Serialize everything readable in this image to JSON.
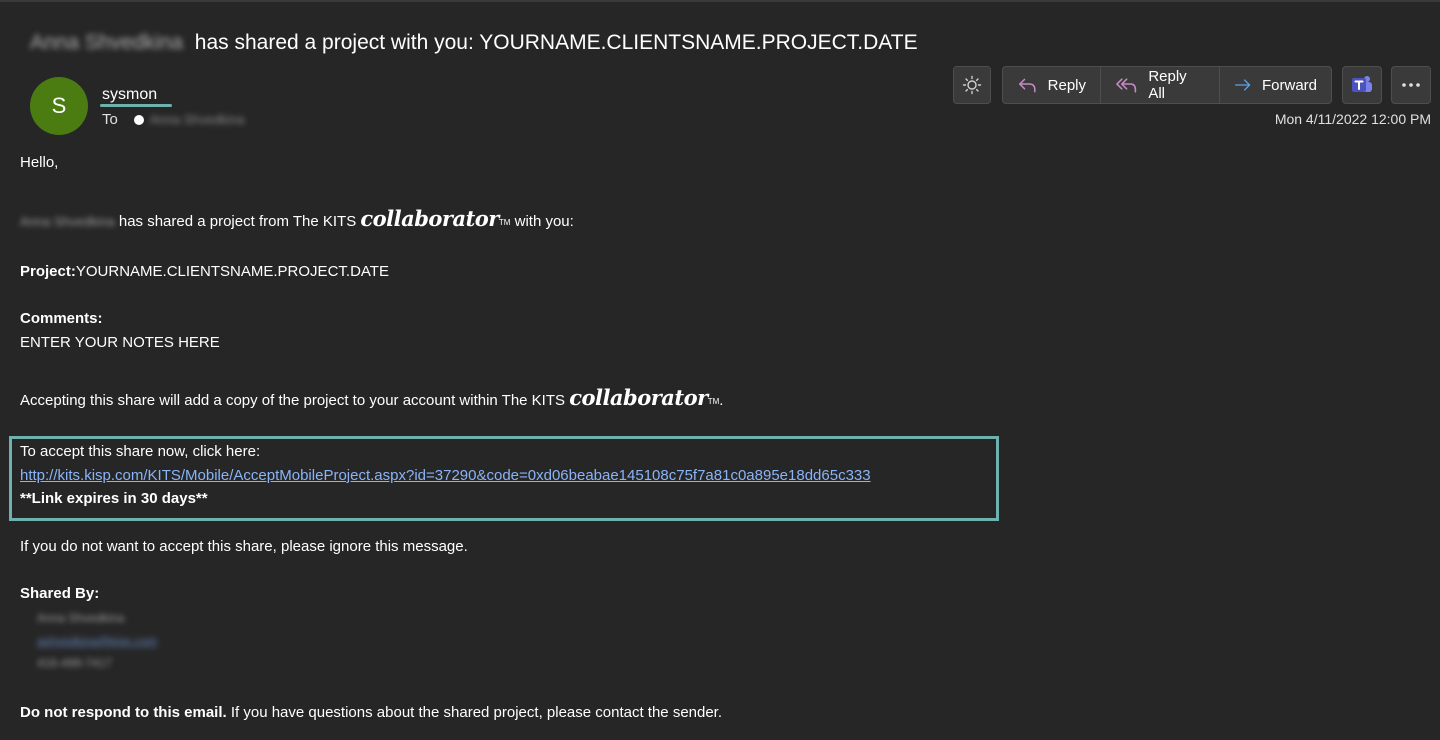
{
  "email": {
    "subject_sender": "Anna Shvedkina",
    "subject": "has shared a project with you: YOURNAME.CLIENTSNAME.PROJECT.DATE",
    "avatar_initial": "S",
    "from": "sysmon",
    "to_label": "To",
    "to_name": "Anna Shvedkina",
    "date": "Mon 4/11/2022 12:00 PM"
  },
  "toolbar": {
    "reply": "Reply",
    "reply_all": "Reply All",
    "forward": "Forward"
  },
  "body": {
    "greeting": "Hello,",
    "sharer_name": "Anna Shvedkina",
    "shared_line_a": "has shared a project from The KITS",
    "collab_word": "collaborator",
    "tm": "TM",
    "shared_line_b": "with you:",
    "project_label": "Project:",
    "project_value": "YOURNAME.CLIENTSNAME.PROJECT.DATE",
    "comments_label": "Comments:",
    "comments_value": "ENTER YOUR NOTES HERE",
    "accepting_a": "Accepting this share will add a copy of the project to your account within The KITS",
    "accepting_b": ".",
    "accept_prompt": "To accept this share now, click here:",
    "accept_link": "http://kits.kisp.com/KITS/Mobile/AcceptMobileProject.aspx?id=37290&code=0xd06beabae145108c75f7a81c0a895e18dd65c333",
    "link_expires": "**Link expires in 30 days**",
    "ignore": "If you do not want to accept this share, please ignore this message.",
    "shared_by_label": "Shared By:",
    "shared_by_name": "Anna Shvedkina",
    "shared_by_email": "ashvedkina@kisp.com",
    "shared_by_phone": "416-499-7417",
    "footer_bold": "Do not respond to this email.",
    "footer_rest": "If you have questions about the shared project, please contact the sender."
  },
  "colors": {
    "background": "#262626",
    "avatar": "#4a7c12",
    "highlight": "#6fb1ae",
    "link": "#8ab4f8",
    "reply_icon": "#c889c9",
    "forward_icon": "#5aa4e6"
  },
  "icons": [
    "sun-icon",
    "reply-icon",
    "reply-all-icon",
    "forward-icon",
    "teams-icon",
    "more-icon"
  ]
}
